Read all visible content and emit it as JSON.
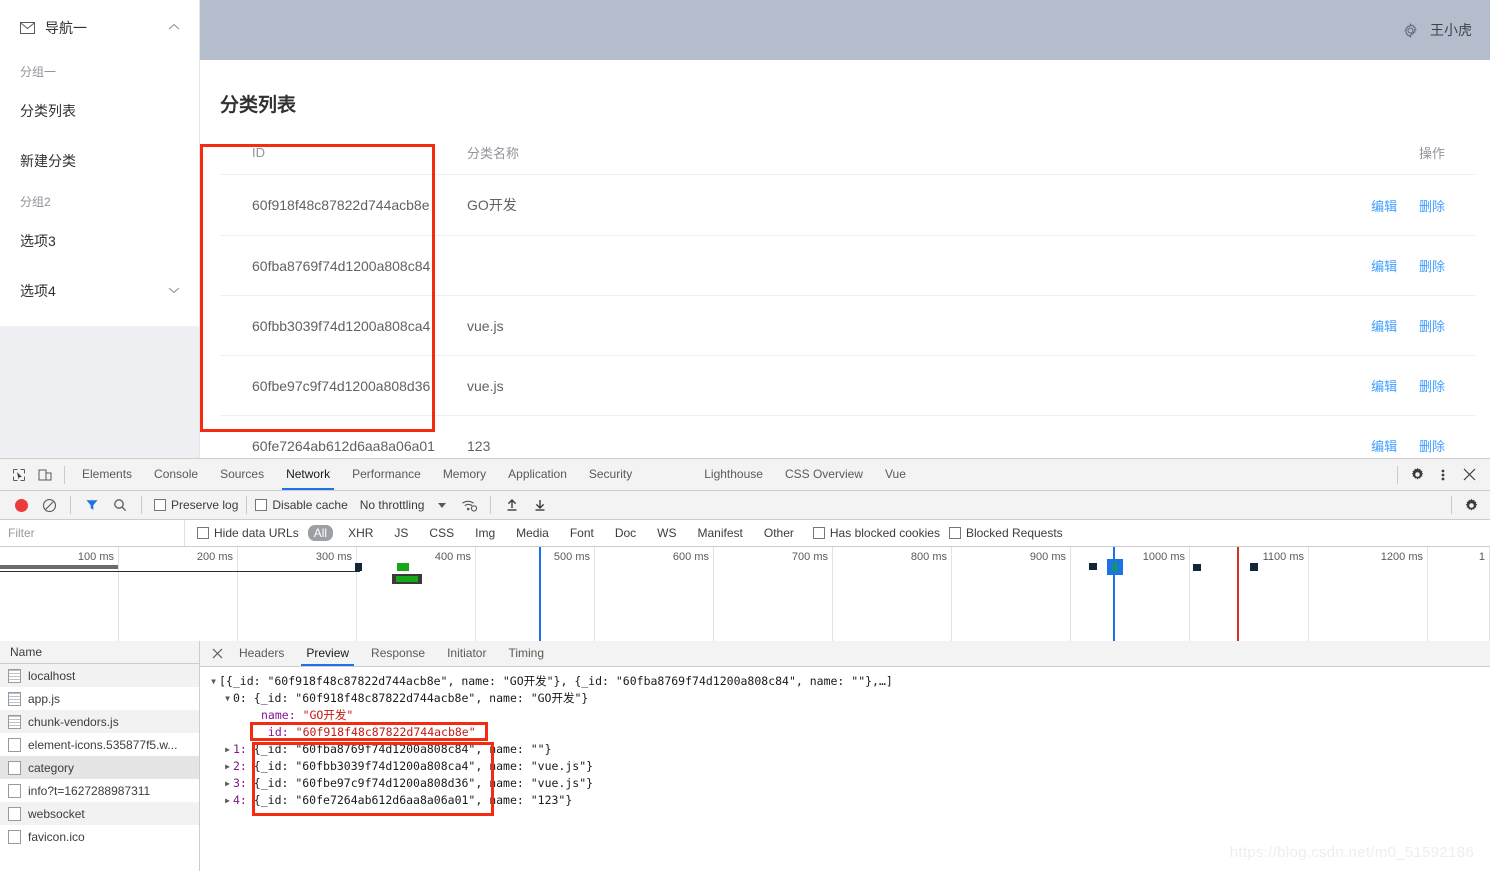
{
  "app": {
    "sidebar": {
      "root": {
        "label": "导航一",
        "icon": "mail-icon",
        "arrow": "chevron-up-icon"
      },
      "groups": [
        {
          "title": "分组一",
          "items": [
            {
              "label": "分类列表",
              "arrow": ""
            },
            {
              "label": "新建分类",
              "arrow": ""
            }
          ]
        },
        {
          "title": "分组2",
          "items": [
            {
              "label": "选项3",
              "arrow": ""
            },
            {
              "label": "选项4",
              "arrow": "chevron-down-icon"
            }
          ]
        }
      ]
    },
    "topbar": {
      "gear_icon": "gear-icon",
      "username": "王小虎",
      "bg": "#b4bdcc"
    },
    "main": {
      "page_title": "分类列表",
      "table": {
        "columns": [
          "ID",
          "分类名称",
          "操作"
        ],
        "rows": [
          {
            "id": "60f918f48c87822d744acb8e",
            "name": "GO开发",
            "edit": "编辑",
            "delete": "删除"
          },
          {
            "id": "60fba8769f74d1200a808c84",
            "name": "",
            "edit": "编辑",
            "delete": "删除"
          },
          {
            "id": "60fbb3039f74d1200a808ca4",
            "name": "vue.js",
            "edit": "编辑",
            "delete": "删除"
          },
          {
            "id": "60fbe97c9f74d1200a808d36",
            "name": "vue.js",
            "edit": "编辑",
            "delete": "删除"
          },
          {
            "id": "60fe7264ab612d6aa8a06a01",
            "name": "123",
            "edit": "编辑",
            "delete": "删除"
          }
        ]
      },
      "link_color": "#409eff"
    }
  },
  "devtools": {
    "accent": "#1a73e8",
    "annotation_color": "#f42b10",
    "left_icons": [
      "inspect-element-icon",
      "device-toolbar-icon"
    ],
    "tabs": [
      {
        "label": "Elements",
        "active": false
      },
      {
        "label": "Console",
        "active": false
      },
      {
        "label": "Sources",
        "active": false
      },
      {
        "label": "Network",
        "active": true
      },
      {
        "label": "Performance",
        "active": false
      },
      {
        "label": "Memory",
        "active": false
      },
      {
        "label": "Application",
        "active": false
      },
      {
        "label": "Security",
        "active": false
      },
      {
        "label": "Lighthouse",
        "active": false
      },
      {
        "label": "CSS Overview",
        "active": false
      },
      {
        "label": "Vue",
        "active": false
      }
    ],
    "tabbar_right_icons": [
      "gear-icon",
      "more-vertical-icon",
      "close-icon"
    ],
    "toolbar": {
      "record_icon": "record-icon",
      "clear_icon": "clear-icon",
      "filter_icon": "filter-icon",
      "search_icon": "search-icon",
      "preserve_log": {
        "label": "Preserve log",
        "checked": false
      },
      "disable_cache": {
        "label": "Disable cache",
        "checked": false
      },
      "throttling": {
        "value": "No throttling"
      },
      "wifi_icon": "network-conditions-icon",
      "import_icon": "upload-har-icon",
      "export_icon": "download-har-icon",
      "settings_icon": "gear-icon"
    },
    "filterbar": {
      "filter_placeholder": "Filter",
      "filter_value": "",
      "hide_data_urls": {
        "label": "Hide data URLs",
        "checked": false
      },
      "types": [
        {
          "label": "All",
          "active": true
        },
        {
          "label": "XHR",
          "active": false
        },
        {
          "label": "JS",
          "active": false
        },
        {
          "label": "CSS",
          "active": false
        },
        {
          "label": "Img",
          "active": false
        },
        {
          "label": "Media",
          "active": false
        },
        {
          "label": "Font",
          "active": false
        },
        {
          "label": "Doc",
          "active": false
        },
        {
          "label": "WS",
          "active": false
        },
        {
          "label": "Manifest",
          "active": false
        },
        {
          "label": "Other",
          "active": false
        }
      ],
      "has_blocked_cookies": {
        "label": "Has blocked cookies",
        "checked": false
      },
      "blocked_requests": {
        "label": "Blocked Requests",
        "checked": false
      }
    },
    "timeline": {
      "ticks": [
        "100 ms",
        "200 ms",
        "300 ms",
        "400 ms",
        "500 ms",
        "600 ms",
        "700 ms",
        "800 ms",
        "900 ms",
        "1000 ms",
        "1100 ms",
        "1200 ms",
        "1"
      ]
    },
    "requests": {
      "header": "Name",
      "items": [
        {
          "name": "localhost",
          "icon": "document-icon",
          "selected": false
        },
        {
          "name": "app.js",
          "icon": "document-icon",
          "selected": false
        },
        {
          "name": "chunk-vendors.js",
          "icon": "document-icon",
          "selected": false
        },
        {
          "name": "element-icons.535877f5.w...",
          "icon": "file-icon",
          "selected": false
        },
        {
          "name": "category",
          "icon": "file-icon",
          "selected": true
        },
        {
          "name": "info?t=1627288987311",
          "icon": "file-icon",
          "selected": false
        },
        {
          "name": "websocket",
          "icon": "file-icon",
          "selected": false
        },
        {
          "name": "favicon.ico",
          "icon": "file-icon",
          "selected": false
        }
      ]
    },
    "detail": {
      "close_icon": "close-icon",
      "tabs": [
        {
          "label": "Headers",
          "active": false
        },
        {
          "label": "Preview",
          "active": true
        },
        {
          "label": "Response",
          "active": false
        },
        {
          "label": "Initiator",
          "active": false
        },
        {
          "label": "Timing",
          "active": false
        }
      ],
      "preview": {
        "root_summary": "[{_id: \"60f918f48c87822d744acb8e\", name: \"GO开发\"}, {_id: \"60fba8769f74d1200a808c84\", name: \"\"},…]",
        "node0_summary": "0: {_id: \"60f918f48c87822d744acb8e\", name: \"GO开发\"}",
        "node0_name_key": "name:",
        "node0_name_val": "\"GO开发\"",
        "node0_id_key": "_id:",
        "node0_id_val": "\"60f918f48c87822d744acb8e\"",
        "children": [
          {
            "index": "1:",
            "body": "{_id: \"60fba8769f74d1200a808c84\", name: \"\"}",
            "id": "\"60fba8769f74d1200a808c84\"",
            "name": "\"\""
          },
          {
            "index": "2:",
            "body": "{_id: \"60fbb3039f74d1200a808ca4\", name: \"vue.js\"}",
            "id": "\"60fbb3039f74d1200a808ca4\"",
            "name": "\"vue.js\""
          },
          {
            "index": "3:",
            "body": "{_id: \"60fbe97c9f74d1200a808d36\", name: \"vue.js\"}",
            "id": "\"60fbe97c9f74d1200a808d36\"",
            "name": "\"vue.js\""
          },
          {
            "index": "4:",
            "body": "{_id: \"60fe7264ab612d6aa8a06a01\", name: \"123\"}",
            "id": "\"60fe7264ab612d6aa8a06a01\"",
            "name": "\"123\""
          }
        ]
      }
    }
  },
  "watermark": "https://blog.csdn.net/m0_51592186"
}
